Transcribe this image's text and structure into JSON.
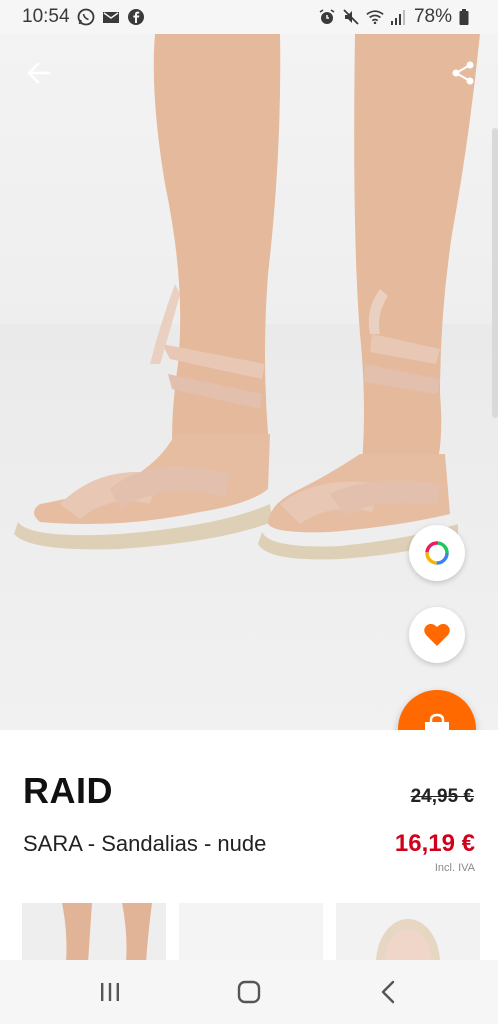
{
  "status_bar": {
    "time": "10:54",
    "battery": "78%"
  },
  "product": {
    "brand": "RAID",
    "name": "SARA - Sandalias - nude",
    "old_price": "24,95 €",
    "new_price": "16,19 €",
    "vat_note": "Incl. IVA"
  },
  "colors": {
    "accent": "#ff6900",
    "sale_price": "#d0011b",
    "wishlist_heart": "#ff6900"
  },
  "icons": {
    "back": "arrow-left-icon",
    "share": "share-icon",
    "similar": "color-ring-icon",
    "wishlist": "heart-icon",
    "cart": "shopping-bag-icon",
    "nav_recents": "recent-apps-icon",
    "nav_home": "home-icon",
    "nav_back": "chevron-left-icon"
  }
}
